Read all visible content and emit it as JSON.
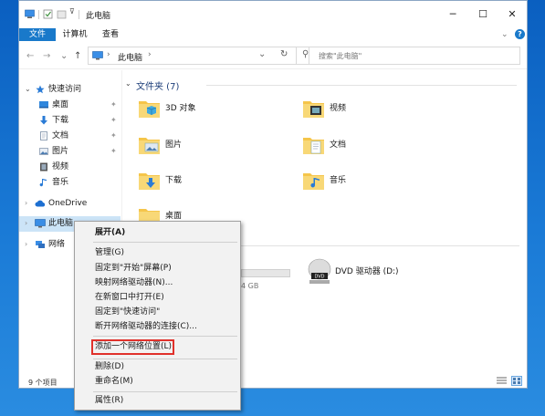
{
  "window": {
    "title": "此电脑"
  },
  "ribbon": {
    "tabs": [
      "文件",
      "计算机",
      "查看"
    ]
  },
  "address": {
    "path": "此电脑",
    "search_placeholder": "搜索\"此电脑\""
  },
  "sidebar": {
    "quick_access": "快速访问",
    "items": [
      "桌面",
      "下载",
      "文档",
      "图片",
      "视频",
      "音乐"
    ],
    "onedrive": "OneDrive",
    "this_pc": "此电脑",
    "network": "网络"
  },
  "content": {
    "section_title": "文件夹 (7)",
    "folders": [
      "3D 对象",
      "视频",
      "图片",
      "文档",
      "下载",
      "音乐",
      "桌面"
    ],
    "drive_label": "DVD 驱动器 (D:)",
    "partial_size": "4 GB"
  },
  "status": {
    "items": "9 个项目"
  },
  "context_menu": {
    "items": [
      "展开(A)",
      "管理(G)",
      "固定到\"开始\"屏幕(P)",
      "映射网络驱动器(N)...",
      "在新窗口中打开(E)",
      "固定到\"快速访问\"",
      "断开网络驱动器的连接(C)...",
      "添加一个网络位置(L)",
      "删除(D)",
      "重命名(M)",
      "属性(R)"
    ]
  },
  "colors": {
    "accent": "#1979ca",
    "highlight_box": "#e0312b",
    "folder": "#f5c54a"
  }
}
